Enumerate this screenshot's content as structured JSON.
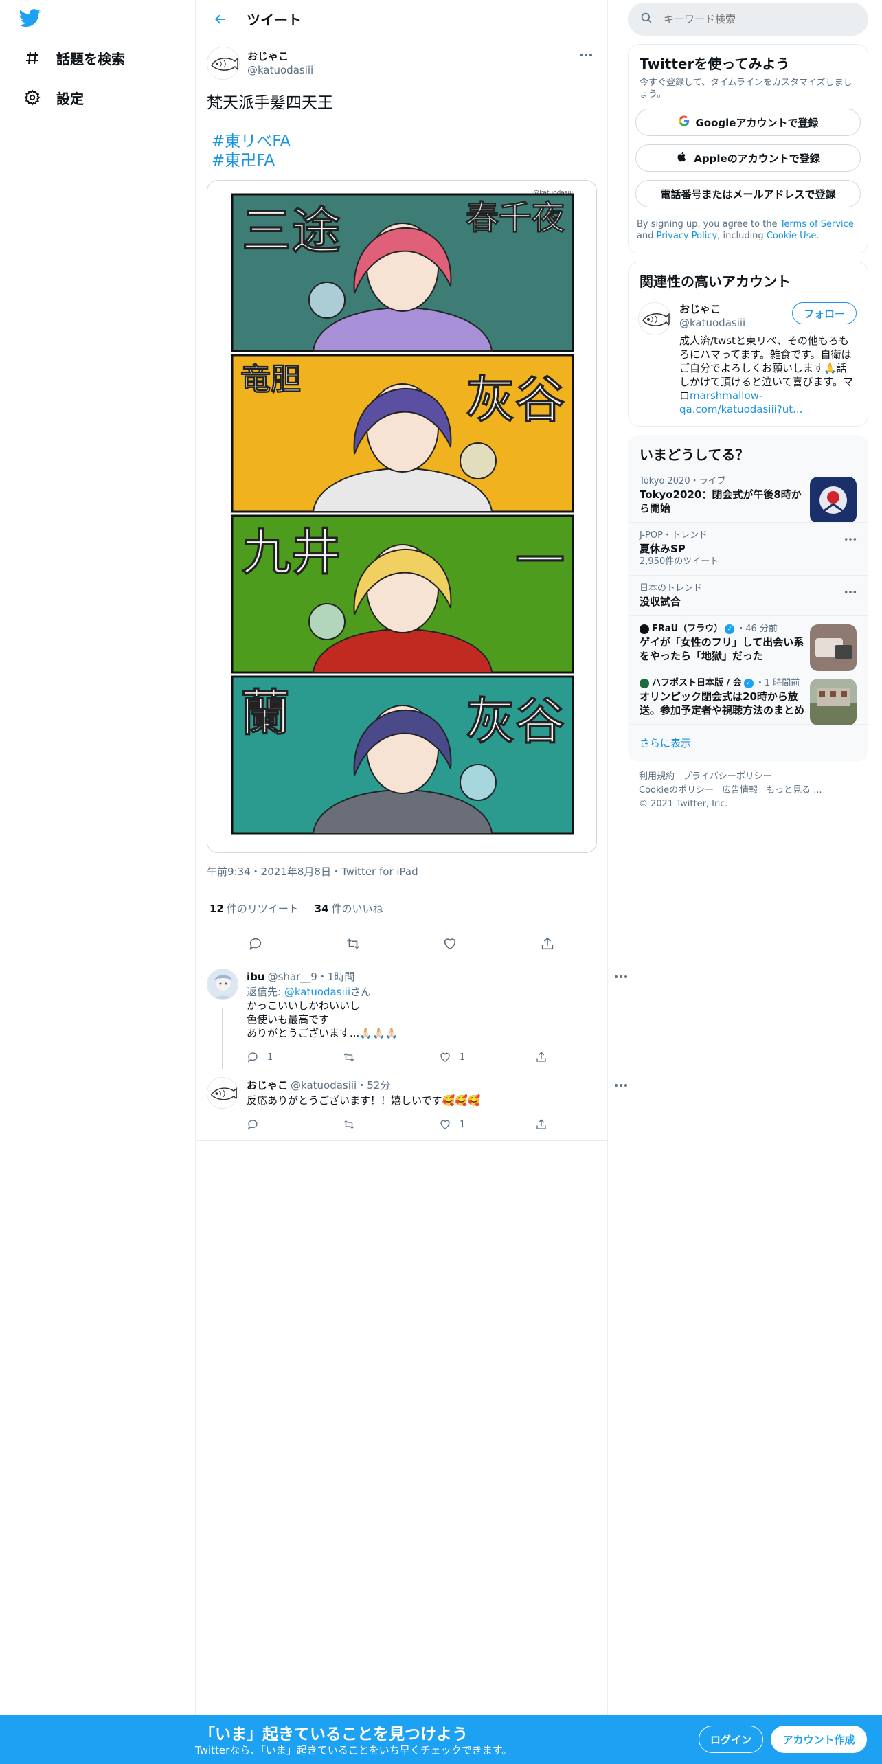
{
  "leftnav": {
    "items": [
      {
        "label": "話題を検索",
        "icon": "hashtag-icon"
      },
      {
        "label": "設定",
        "icon": "gear-icon"
      }
    ]
  },
  "header": {
    "title": "ツイート"
  },
  "tweet": {
    "name": "おじゃこ",
    "handle": "@katuodasiii",
    "text": "梵天派手髪四天王",
    "hashtags": [
      "#東リべFA",
      "#東卍FA"
    ],
    "watermark": "@katuodasiii",
    "panels": [
      {
        "left": "三途",
        "right": "春千夜",
        "bg": "#3d7d76"
      },
      {
        "left": "竜胆",
        "right": "灰谷",
        "bg": "#f0b21e"
      },
      {
        "left": "九井",
        "right": "一",
        "bg": "#4e9c1e"
      },
      {
        "left": "蘭",
        "right": "灰谷",
        "bg": "#2b9a8f"
      }
    ],
    "meta": "午前9:34・2021年8月8日・Twitter for iPad",
    "retweets": "12",
    "retweets_label": "件のリツイート",
    "likes": "34",
    "likes_label": "件のいいね"
  },
  "replies": [
    {
      "name": "ibu",
      "handle": "@shar__9",
      "time": "・1時間",
      "reply_to_prefix": "返信先: ",
      "reply_to": "@katuodasiii",
      "reply_to_suffix": "さん",
      "lines": [
        "かっこいいしかわいいし",
        "色使いも最高です",
        "ありがとうございます...🙏🏻🙏🏻🙏🏻"
      ],
      "reply_count": "1",
      "retweet_count": "",
      "like_count": "1"
    },
    {
      "name": "おじゃこ",
      "handle": "@katuodasiii",
      "time": "・52分",
      "lines": [
        "反応ありがとうございます！！嬉しいです🥰🥰🥰"
      ],
      "reply_count": "",
      "retweet_count": "",
      "like_count": "1"
    }
  ],
  "search": {
    "placeholder": "キーワード検索"
  },
  "signup": {
    "title": "Twitterを使ってみよう",
    "subtitle": "今すぐ登録して、タイムラインをカスタマイズしましょう。",
    "google": "Googleアカウントで登録",
    "apple": "Appleのアカウントで登録",
    "phone": "電話番号またはメールアドレスで登録",
    "legal_1": "By signing up, you agree to the ",
    "tos": "Terms of Service",
    "legal_2": " and ",
    "privacy": "Privacy Policy",
    "legal_3": ", including ",
    "cookie": "Cookie Use",
    "legal_4": "."
  },
  "related": {
    "title": "関連性の高いアカウント",
    "name": "おじゃこ",
    "handle": "@katuodasiii",
    "follow": "フォロー",
    "bio": "成人済/twstと東リべ、その他もろもろにハマってます。雑食です。自衛はご自分でよろしくお願いします🙏話しかけて頂けると泣いて喜びます。マロ",
    "bio_link": "marshmallow-qa.com/katuodasiii?ut..."
  },
  "trends": {
    "title": "いまどうしてる？",
    "items": [
      {
        "context": "Tokyo 2020・ライブ",
        "name": "Tokyo2020：閉会式が午後8時から開始",
        "count": "",
        "thumb": true
      },
      {
        "context": "J-POP・トレンド",
        "name": "夏休みSP",
        "count": "2,950件のツイート",
        "more": true
      },
      {
        "context": "日本のトレンド",
        "name": "没収試合",
        "count": "",
        "more": true
      },
      {
        "context": "FRaU（フラウ）",
        "context2": "・46 分前",
        "name": "ゲイが「女性のフリ」して出会い系をやったら「地獄」だった",
        "count": "",
        "thumb": true,
        "verified": true
      },
      {
        "context": "ハフポスト日本版 / 会",
        "context2": "・1 時間前",
        "name": "オリンピック閉会式は20時から放送。参加予定者や視聴方法のまとめ",
        "count": "",
        "thumb": true,
        "verified": true
      }
    ],
    "show_more": "さらに表示"
  },
  "footer": {
    "links": [
      "利用規約",
      "プライバシーポリシー",
      "Cookieのポリシー",
      "広告情報",
      "もっと見る ..."
    ],
    "copyright": "© 2021 Twitter, Inc."
  },
  "bottombar": {
    "title": "「いま」起きていることを見つけよう",
    "subtitle": "Twitterなら、「いま」起きていることをいち早くチェックできます。",
    "login": "ログイン",
    "signup": "アカウント作成"
  },
  "colors": {
    "accent": "#1da1f2",
    "link": "#1b95e0"
  }
}
